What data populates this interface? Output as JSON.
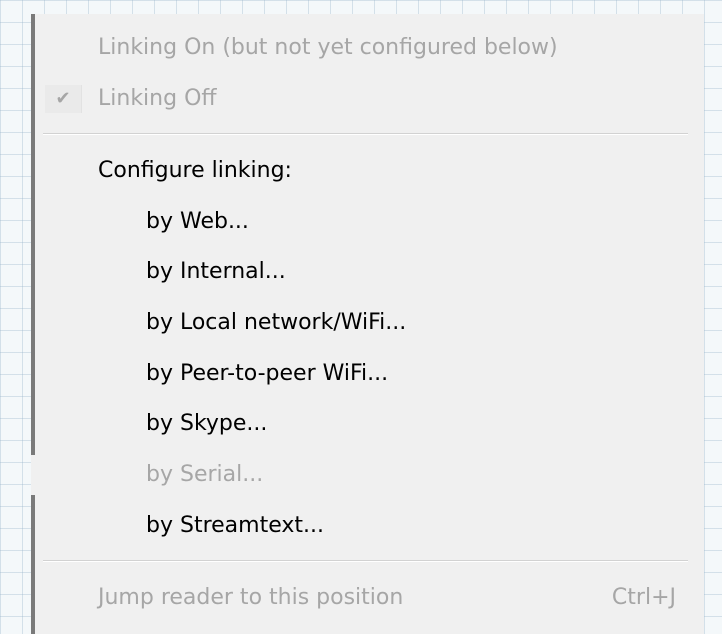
{
  "menu": {
    "linking_on": "Linking On (but not yet configured below)",
    "linking_off": "Linking Off",
    "configure_header": "Configure linking:",
    "items": [
      {
        "label": "by Web..."
      },
      {
        "label": "by Internal..."
      },
      {
        "label": "by Local network/WiFi..."
      },
      {
        "label": "by Peer-to-peer WiFi..."
      },
      {
        "label": "by Skype..."
      },
      {
        "label": "by Serial..."
      },
      {
        "label": "by Streamtext..."
      }
    ],
    "jump_reader": "Jump reader to this position",
    "jump_shortcut": "Ctrl+J"
  },
  "colors": {
    "menu_background": "#f0f0f0",
    "enabled_text": "#000000",
    "disabled_text": "#a6a6a6"
  },
  "icons": {
    "checked": "checkmark-icon"
  }
}
